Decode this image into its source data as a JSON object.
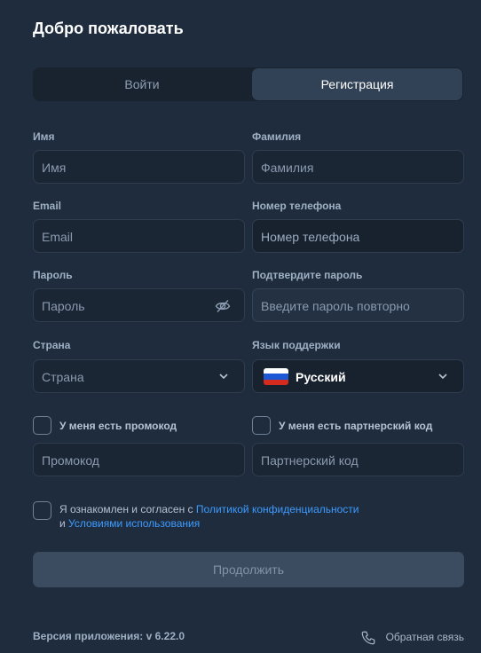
{
  "header": {
    "title": "Добро пожаловать"
  },
  "tabs": {
    "login": "Войти",
    "register": "Регистрация"
  },
  "form": {
    "first_name": {
      "label": "Имя",
      "placeholder": "Имя"
    },
    "last_name": {
      "label": "Фамилия",
      "placeholder": "Фамилия"
    },
    "email": {
      "label": "Email",
      "placeholder": "Email"
    },
    "phone": {
      "label": "Номер телефона",
      "placeholder": "Номер телефона"
    },
    "password": {
      "label": "Пароль",
      "placeholder": "Пароль",
      "icon": "eye-off-icon"
    },
    "password_confirm": {
      "label": "Подтвердите пароль",
      "placeholder": "Введите пароль повторно"
    },
    "country": {
      "label": "Страна",
      "placeholder": "Страна"
    },
    "support_language": {
      "label": "Язык поддержки",
      "value": "Русский",
      "flag_colors": [
        "#ffffff",
        "#1c57d6",
        "#d52b1e"
      ]
    },
    "promo": {
      "checkbox_label": "У меня есть промокод",
      "placeholder": "Промокод"
    },
    "partner": {
      "checkbox_label": "У меня есть партнерский код",
      "placeholder": "Партнерский код"
    },
    "agreement": {
      "prefix": "Я ознакомлен и согласен с",
      "privacy_link": "Политикой конфиденциальности",
      "conjunction": "и",
      "terms_link": "Условиями использования"
    },
    "continue_button": "Продолжить"
  },
  "footer": {
    "version": "Версия приложения: v 6.22.0",
    "feedback": "Обратная связь"
  },
  "colors": {
    "background": "#1f2c3d",
    "link": "#3d9bff",
    "button_disabled": "#3b4b60"
  }
}
